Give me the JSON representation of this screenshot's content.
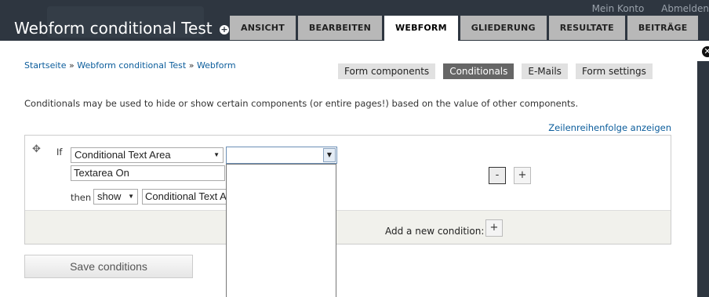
{
  "header": {
    "site_title": "Webform conditional Test",
    "title_toggle_symbol": "+",
    "top_links": [
      "Mein Konto",
      "Abmelden"
    ]
  },
  "tabs": [
    {
      "label": "ANSICHT",
      "active": false
    },
    {
      "label": "BEARBEITEN",
      "active": false
    },
    {
      "label": "WEBFORM",
      "active": true
    },
    {
      "label": "GLIEDERUNG",
      "active": false
    },
    {
      "label": "RESULTATE",
      "active": false
    },
    {
      "label": "BEITRÄGE",
      "active": false
    }
  ],
  "breadcrumb": {
    "items": [
      "Startseite",
      "Webform conditional Test",
      "Webform"
    ],
    "separator": "»"
  },
  "subtabs": [
    {
      "label": "Form components",
      "active": false
    },
    {
      "label": "Conditionals",
      "active": true
    },
    {
      "label": "E-Mails",
      "active": false
    },
    {
      "label": "Form settings",
      "active": false
    }
  ],
  "description": "Conditionals may be used to hide or show certain components (or entire pages!) based on the value of other components.",
  "row_weights_link": "Zeilenreihenfolge anzeigen",
  "condition": {
    "if_label": "If",
    "source_select": "Conditional Text Area",
    "operator_combo": "",
    "value_field": "Textarea On",
    "then_label": "then",
    "action_select": "show",
    "target_select": "Conditional Text Area",
    "remove_button": "-",
    "add_button": "+"
  },
  "footer": {
    "add_condition_label": "Add a new condition:",
    "add_condition_button": "+"
  },
  "save_button": "Save conditions",
  "colors": {
    "header_bg": "#2e3640",
    "active_subtab_bg": "#666666",
    "link": "#0a5c9b"
  }
}
